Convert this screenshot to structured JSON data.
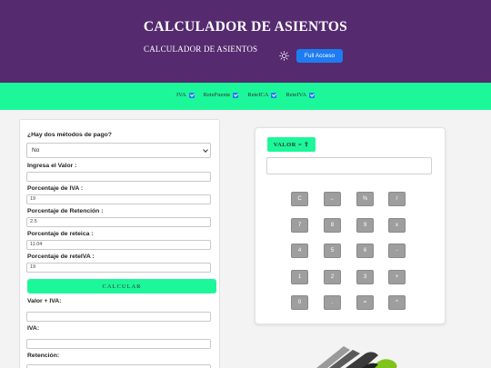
{
  "header": {
    "title": "CALCULADOR DE ASIENTOS",
    "subtitle": "CALCULADOR DE ASIENTOS",
    "full_access": "Full Acceso",
    "bg_color": "#552a6e"
  },
  "nav": {
    "bg_color": "#1cf79a",
    "items": [
      {
        "label": "IVA",
        "checked": true
      },
      {
        "label": "ReteFuente",
        "checked": true
      },
      {
        "label": "ReteICA",
        "checked": true
      },
      {
        "label": "ReteIVA",
        "checked": true
      }
    ]
  },
  "form": {
    "payment_question": "¿Hay dos métodos de pago?",
    "payment_selected": "No",
    "value_label": "Ingresa el Valor :",
    "value_value": "",
    "iva_label": "Porcentaje de IVA :",
    "iva_value": "19",
    "retencion_label": "Porcentaje de Retención :",
    "retencion_value": "2.5",
    "reteica_label": "Porcentaje de reteica :",
    "reteica_value": "11.04",
    "reteiva_label": "Porcentaje de reteIVA :",
    "reteiva_value": "19",
    "calc_label": "CALCULAR",
    "valor_iva_label": "Valor + IVA:",
    "iva_result_label": "IVA:",
    "retencion_result_label": "Retención:"
  },
  "calculator": {
    "badge": "VALOR = ⇧",
    "display": "",
    "keys": [
      [
        "C",
        "←",
        "%",
        "/"
      ],
      [
        "7",
        "8",
        "9",
        "x"
      ],
      [
        "4",
        "5",
        "6",
        "-"
      ],
      [
        "1",
        "2",
        "3",
        "+"
      ],
      [
        "0",
        ".",
        "=",
        "^"
      ]
    ]
  }
}
